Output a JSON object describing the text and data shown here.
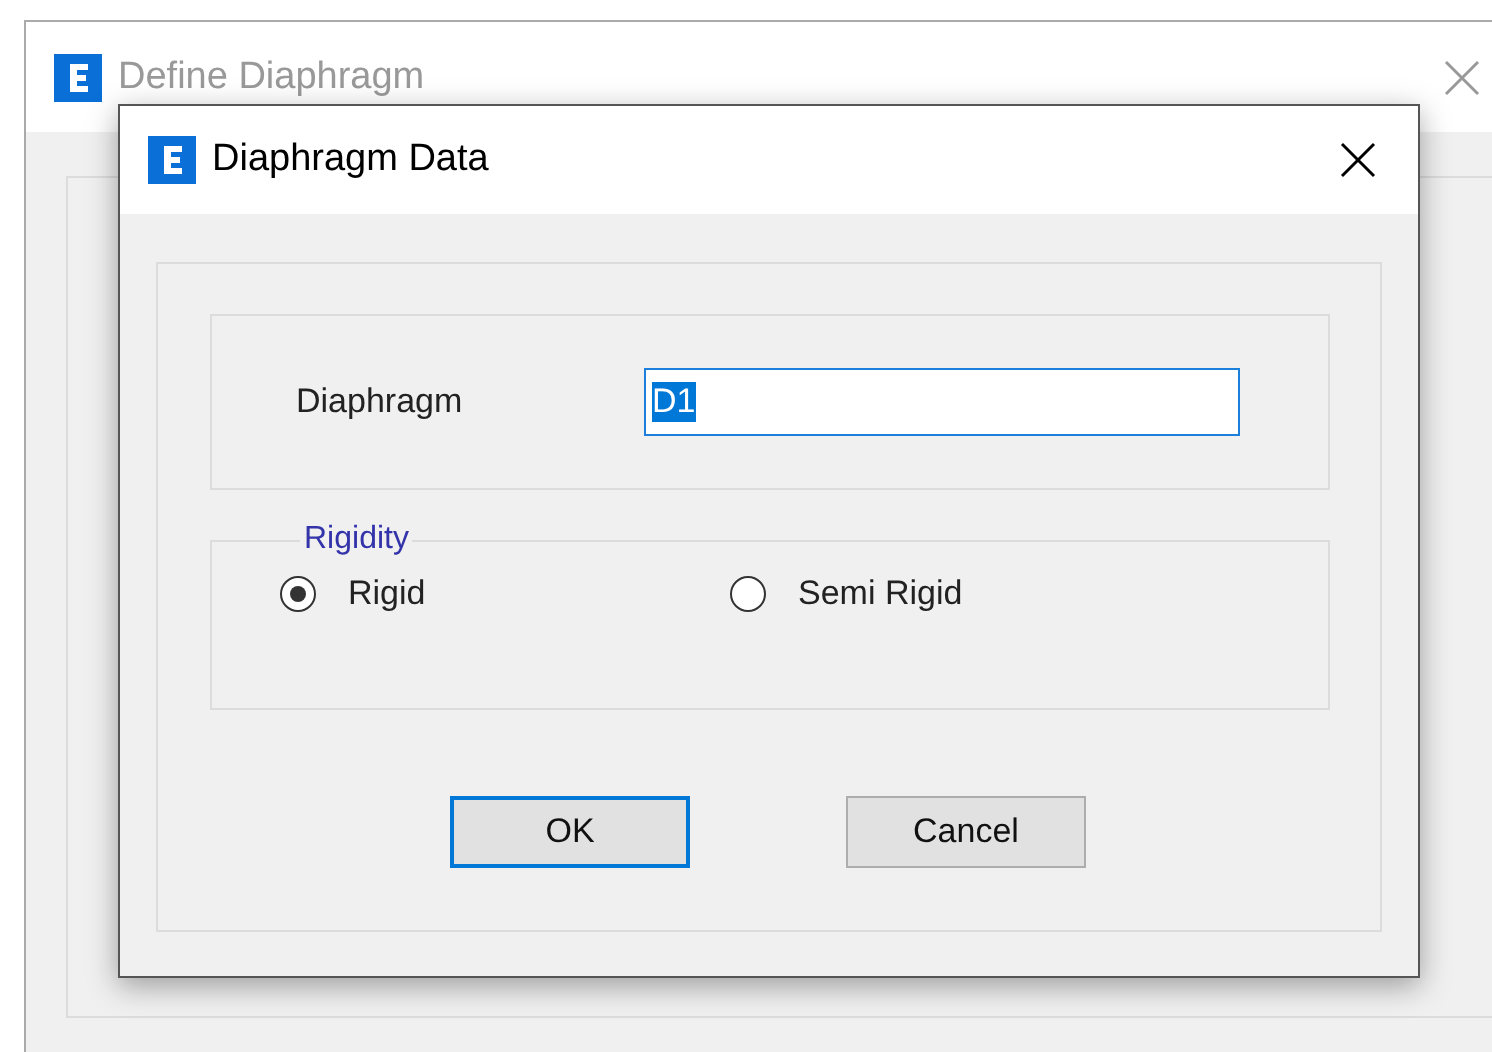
{
  "back_window": {
    "title": "Define Diaphragm",
    "active": false
  },
  "dialog": {
    "title": "Diaphragm Data",
    "active": true
  },
  "diaphragm": {
    "label": "Diaphragm",
    "value": "D1",
    "text_selected": true
  },
  "rigidity": {
    "legend": "Rigidity",
    "options": [
      {
        "label": "Rigid",
        "selected": true
      },
      {
        "label": "Semi Rigid",
        "selected": false
      }
    ]
  },
  "buttons": [
    {
      "label": "OK",
      "default": true
    },
    {
      "label": "Cancel",
      "default": false
    }
  ]
}
